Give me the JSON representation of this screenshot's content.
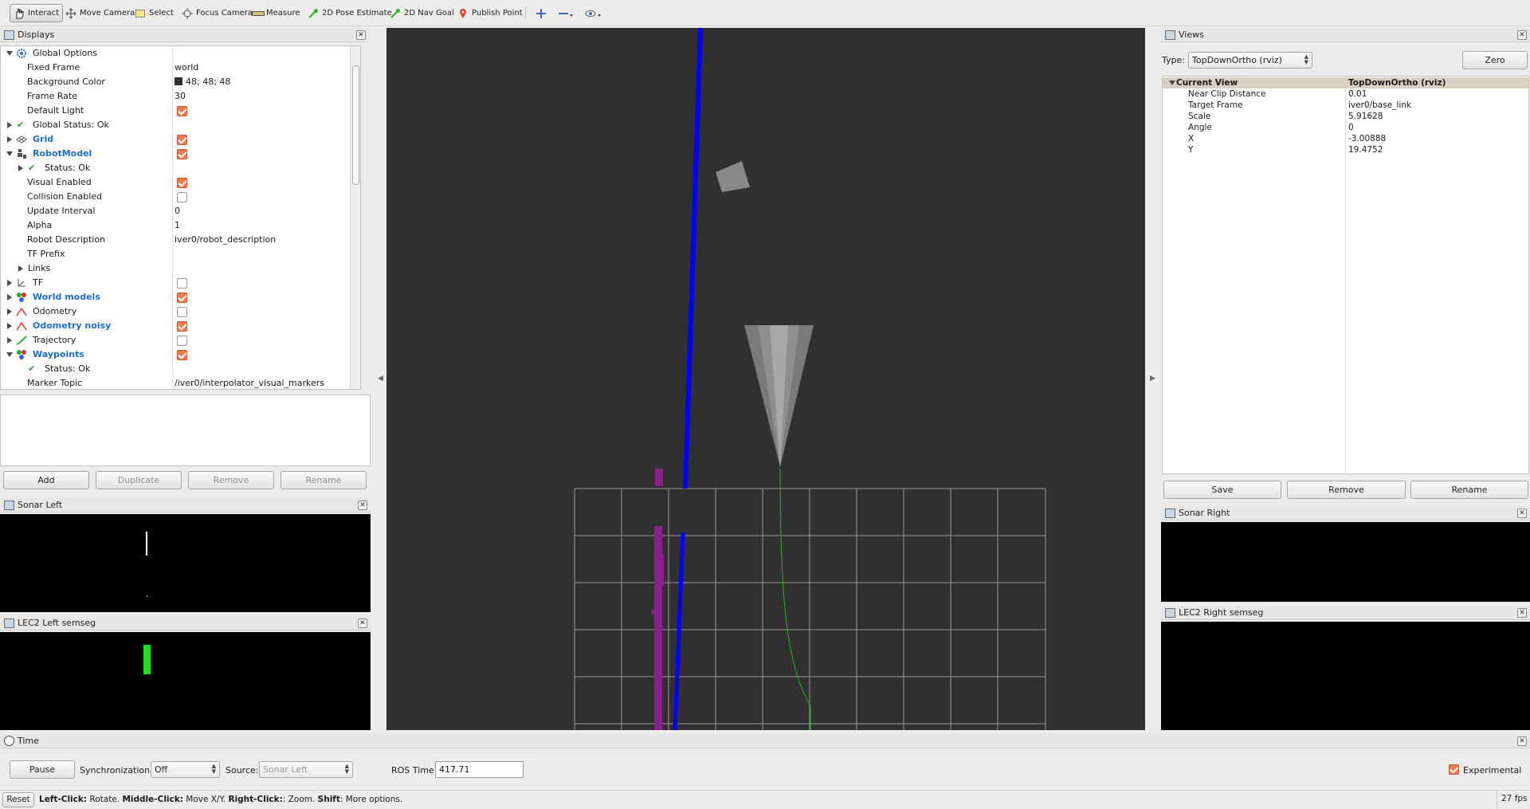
{
  "toolbar": {
    "interact": "Interact",
    "move_camera": "Move Camera",
    "select": "Select",
    "focus_camera": "Focus Camera",
    "measure": "Measure",
    "pose_estimate": "2D Pose Estimate",
    "nav_goal": "2D Nav Goal",
    "publish_point": "Publish Point"
  },
  "displays": {
    "title": "Displays",
    "rows": {
      "global_options": "Global Options",
      "fixed_frame": "Fixed Frame",
      "fixed_frame_val": "world",
      "bg_color": "Background Color",
      "bg_color_val": "48; 48; 48",
      "frame_rate": "Frame Rate",
      "frame_rate_val": "30",
      "default_light": "Default Light",
      "global_status": "Global Status: Ok",
      "grid": "Grid",
      "robot_model": "RobotModel",
      "status_ok": "Status: Ok",
      "visual_enabled": "Visual Enabled",
      "collision_enabled": "Collision Enabled",
      "update_interval": "Update Interval",
      "update_interval_val": "0",
      "alpha": "Alpha",
      "alpha_val": "1",
      "robot_description": "Robot Description",
      "robot_description_val": "iver0/robot_description",
      "tf_prefix": "TF Prefix",
      "links": "Links",
      "tf": "TF",
      "world_models": "World models",
      "odometry": "Odometry",
      "odometry_noisy": "Odometry noisy",
      "trajectory": "Trajectory",
      "waypoints": "Waypoints",
      "status_ok2": "Status: Ok",
      "marker_topic": "Marker Topic",
      "marker_topic_val": "/iver0/interpolator_visual_markers"
    },
    "buttons": {
      "add": "Add",
      "duplicate": "Duplicate",
      "remove": "Remove",
      "rename": "Rename"
    }
  },
  "sonar_left": {
    "title": "Sonar Left"
  },
  "lec2_left": {
    "title": "LEC2 Left semseg"
  },
  "views": {
    "title": "Views",
    "type_label": "Type:",
    "type_value": "TopDownOrtho (rviz)",
    "zero": "Zero",
    "current_view": "Current View",
    "current_view_val": "TopDownOrtho (rviz)",
    "props": [
      {
        "k": "Near Clip Distance",
        "v": "0.01"
      },
      {
        "k": "Target Frame",
        "v": "iver0/base_link"
      },
      {
        "k": "Scale",
        "v": "5.91628"
      },
      {
        "k": "Angle",
        "v": "0"
      },
      {
        "k": "X",
        "v": "-3.00888"
      },
      {
        "k": "Y",
        "v": "19.4752"
      }
    ],
    "save": "Save",
    "remove": "Remove",
    "rename": "Rename"
  },
  "sonar_right": {
    "title": "Sonar Right"
  },
  "lec2_right": {
    "title": "LEC2 Right semseg"
  },
  "time": {
    "title": "Time",
    "pause": "Pause",
    "sync_label": "Synchronization:",
    "sync_value": "Off",
    "source_label": "Source:",
    "source_value": "Sonar Left",
    "ros_time_label": "ROS Time:",
    "ros_time_value": "417.71",
    "experimental": "Experimental"
  },
  "status": {
    "reset": "Reset",
    "hint_1b": "Left-Click:",
    "hint_1": " Rotate. ",
    "hint_2b": "Middle-Click:",
    "hint_2": " Move X/Y. ",
    "hint_3b": "Right-Click:",
    "hint_3": ": Zoom. ",
    "hint_4b": "Shift",
    "hint_4": ": More options.",
    "fps": "27 fps"
  },
  "colors": {
    "background": "#303030",
    "path": "#0000ff",
    "accent": "#ef7b4e"
  }
}
